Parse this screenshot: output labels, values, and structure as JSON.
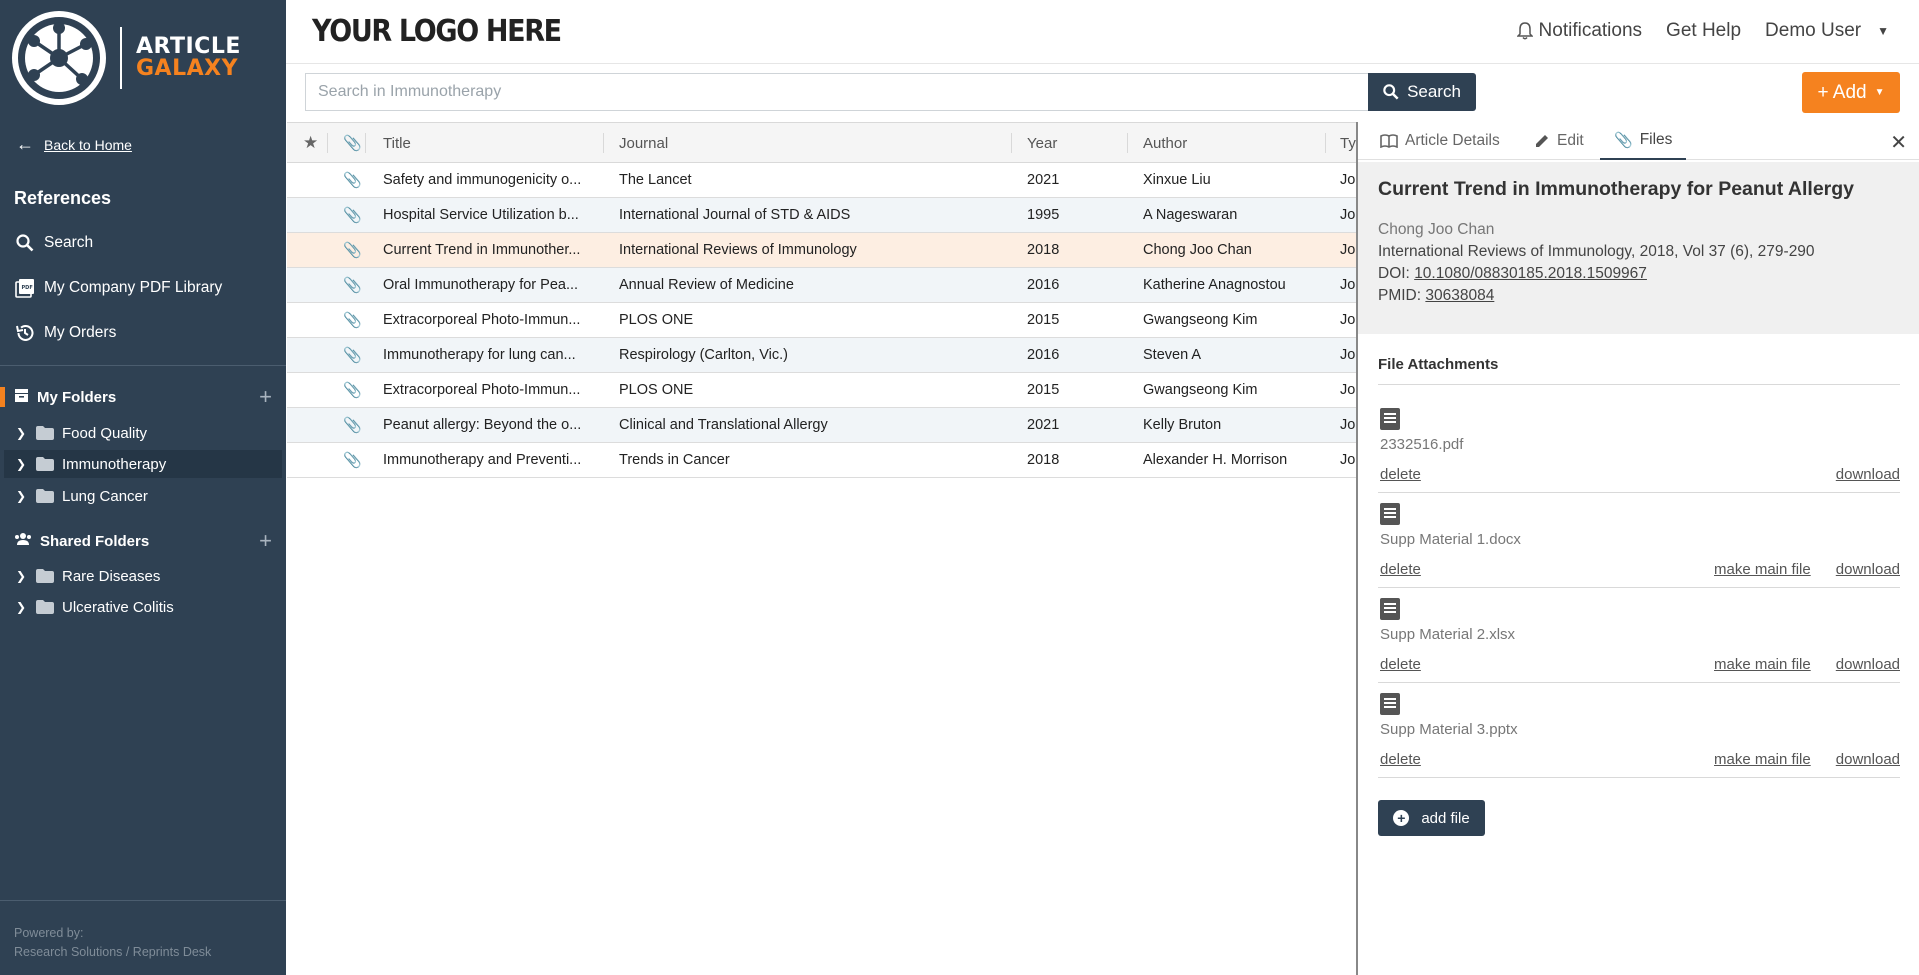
{
  "brand": {
    "line1": "ARTICLE",
    "line2": "GALAXY",
    "company_logo": "YOUR LOGO HERE",
    "accent": "#f5821f",
    "sidebar_bg": "#2f4153"
  },
  "sidebar": {
    "back_label": "Back to Home",
    "references_title": "References",
    "nav": [
      {
        "label": "Search",
        "icon": "search-icon"
      },
      {
        "label": "My Company PDF Library",
        "icon": "pdf-icon"
      },
      {
        "label": "My Orders",
        "icon": "history-icon"
      }
    ],
    "my_folders_title": "My Folders",
    "my_folders": [
      {
        "label": "Food Quality"
      },
      {
        "label": "Immunotherapy"
      },
      {
        "label": "Lung Cancer"
      }
    ],
    "shared_folders_title": "Shared Folders",
    "shared_folders": [
      {
        "label": "Rare Diseases"
      },
      {
        "label": "Ulcerative Colitis"
      }
    ],
    "powered_by": "Powered by:",
    "powered_by_company": "Research Solutions / Reprints Desk"
  },
  "topbar": {
    "notifications": "Notifications",
    "help": "Get Help",
    "user": "Demo User"
  },
  "search": {
    "placeholder": "Search in Immunotherapy",
    "button": "Search",
    "add_button": "+ Add"
  },
  "table": {
    "columns": {
      "title": "Title",
      "journal": "Journal",
      "year": "Year",
      "author": "Author",
      "type": "Ty"
    },
    "rows": [
      {
        "title": "Safety and immunogenicity o...",
        "journal": "The Lancet",
        "year": "2021",
        "author": "Xinxue Liu",
        "type": "Jo"
      },
      {
        "title": "Hospital Service Utilization b...",
        "journal": "International Journal of STD & AIDS",
        "year": "1995",
        "author": "A Nageswaran",
        "type": "Jo"
      },
      {
        "title": "Current Trend in Immunother...",
        "journal": "International Reviews of Immunology",
        "year": "2018",
        "author": "Chong Joo Chan",
        "type": "Jo"
      },
      {
        "title": "Oral Immunotherapy for Pea...",
        "journal": "Annual Review of Medicine",
        "year": "2016",
        "author": "Katherine Anagnostou",
        "type": "Jo"
      },
      {
        "title": "Extracorporeal Photo-Immun...",
        "journal": "PLOS ONE",
        "year": "2015",
        "author": "Gwangseong Kim",
        "type": "Jo"
      },
      {
        "title": "Immunotherapy for lung can...",
        "journal": "Respirology (Carlton, Vic.)",
        "year": "2016",
        "author": "Steven A",
        "type": "Jo"
      },
      {
        "title": "Extracorporeal Photo-Immun...",
        "journal": "PLOS ONE",
        "year": "2015",
        "author": "Gwangseong Kim",
        "type": "Jo"
      },
      {
        "title": "Peanut allergy: Beyond the o...",
        "journal": "Clinical and Translational Allergy",
        "year": "2021",
        "author": "Kelly Bruton",
        "type": "Jo"
      },
      {
        "title": "Immunotherapy and Preventi...",
        "journal": "Trends in Cancer",
        "year": "2018",
        "author": "Alexander H. Morrison",
        "type": "Jo"
      }
    ]
  },
  "panel": {
    "tabs": {
      "details": "Article Details",
      "edit": "Edit",
      "files": "Files"
    },
    "article": {
      "title": "Current Trend in Immunotherapy for Peanut Allergy",
      "author": "Chong Joo Chan",
      "citation": "International Reviews of Immunology, 2018, Vol 37 (6), 279-290",
      "doi_label": "DOI:",
      "doi": "10.1080/08830185.2018.1509967",
      "pmid_label": "PMID:",
      "pmid": "30638084"
    },
    "attachments_title": "File Attachments",
    "files": [
      {
        "name": "2332516.pdf",
        "delete": "delete",
        "make_main": "",
        "download": "download"
      },
      {
        "name": "Supp Material 1.docx",
        "delete": "delete",
        "make_main": "make main file",
        "download": "download"
      },
      {
        "name": "Supp Material 2.xlsx",
        "delete": "delete",
        "make_main": "make main file",
        "download": "download"
      },
      {
        "name": "Supp Material 3.pptx",
        "delete": "delete",
        "make_main": "make main file",
        "download": "download"
      }
    ],
    "add_file": "add file"
  }
}
